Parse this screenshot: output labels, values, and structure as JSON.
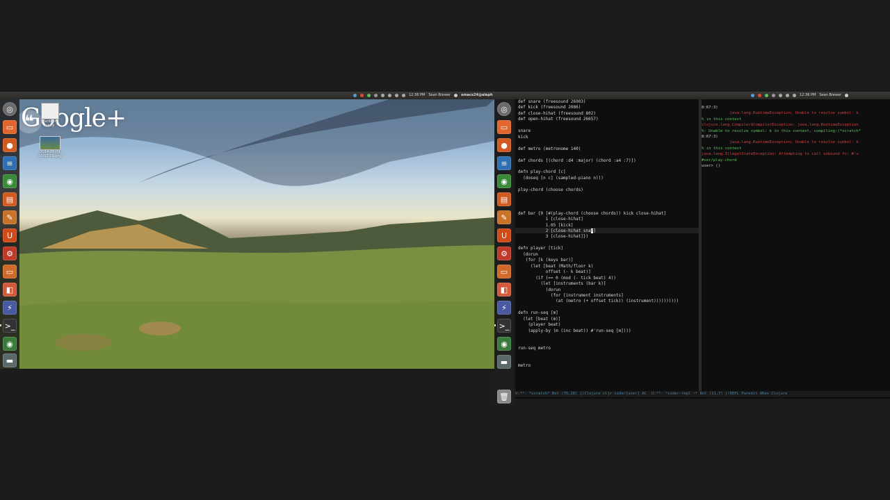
{
  "left_panel": {
    "time": "12:36 PM",
    "user": "Sean Brewer",
    "window_title": "emacs24@aleph"
  },
  "right_panel": {
    "time": "12:36 PM",
    "user": "Sean Brewer"
  },
  "desktop": {
    "gplus_text": "Google+",
    "icons": [
      {
        "label": "Hardcore unity"
      },
      {
        "label": "2014-06-09 00:32:19.png"
      }
    ]
  },
  "launcher_icons": [
    "dash-home",
    "files",
    "firefox",
    "libreoffice-writer",
    "chrome",
    "ubuntu-software",
    "text-editor",
    "ubuntu-one",
    "system-settings",
    "files-2",
    "impress",
    "workspace-switcher",
    "terminal",
    "chromium",
    "drive"
  ],
  "editor": {
    "lines": [
      "def snare (freesound 26903)",
      "def kick (freesound 2086)",
      "def close-hihat (freesound 802)",
      "def open-hihat (freesound 26657)",
      "",
      "snare",
      "kick",
      "",
      "def metro (metronome 140)",
      "",
      "def chords [(chord :d4 :major) (chord :a4 :7)])",
      "",
      "defn play-chord [c]",
      "  (doseq [n c] (sampled-piano n)))",
      "",
      "play-chord (choose chords)",
      "",
      "",
      "",
      "def bar {0 [#(play-chord (choose chords)) kick close-hihat]",
      "           1 [close-hihat]",
      "           1.05 [kick]",
      "           2 [close-hihat sna",
      "           3 [close-hihat]})",
      "",
      "defn player [tick]",
      "  (dorun",
      "   (for [k (keys bar)]",
      "     (let [beat (Math/floor k)",
      "           offset (- k beat)]",
      "       (if (== 0 (mod (- tick beat) 4))",
      "         (let [instruments (bar k)]",
      "           (dorun",
      "             (for [instrument instruments]",
      "               (at (metro (+ offset tick)) (instrument))))))))))",
      "",
      "defn run-seq [m]",
      "  (let [beat (m)]",
      "    (player beat)",
      "    (apply-by (m (inc beat)) #'run-seq [m])))",
      "",
      "",
      "run-seq metro",
      "",
      "",
      "metro"
    ],
    "cursor_tail": "r",
    "after_cursor": "]",
    "modeline": "U:**-  *scratch*      Bot (76,28)    [(Clojure cljr cider[user] AC"
  },
  "repl": {
    "lines": [
      {
        "text": "8:67:3)",
        "color": "#cfcfcf"
      },
      {
        "text": "            java.lang.RuntimeException: Unable to resolve symbol: k",
        "color": "#d04040"
      },
      {
        "text": "% in this context",
        "color": "#60c060"
      },
      {
        "text": "clojure.lang.Compiler$CompilerException: java.lang.RuntimeException",
        "color": "#d04040"
      },
      {
        "text": "%: Unable to resolve symbol: k in this context, compiling:(*scratch*",
        "color": "#60c060"
      },
      {
        "text": "8:67:3)",
        "color": "#cfcfcf"
      },
      {
        "text": "            java.lang.RuntimeException: Unable to resolve symbol: k",
        "color": "#d04040"
      },
      {
        "text": "% in this context",
        "color": "#60c060"
      },
      {
        "text": "java.lang.IllegalStateException: Attempting to call unbound fn: #'u",
        "color": "#d04040"
      },
      {
        "text": "#ser/play-chord",
        "color": "#60c060"
      },
      {
        "text": "user> ()",
        "color": "#cfcfcf"
      }
    ],
    "modeline": "U:**-  *cider-repl ~*      Bot (11,7)      [(REPL Paredit ARev Clojure"
  }
}
